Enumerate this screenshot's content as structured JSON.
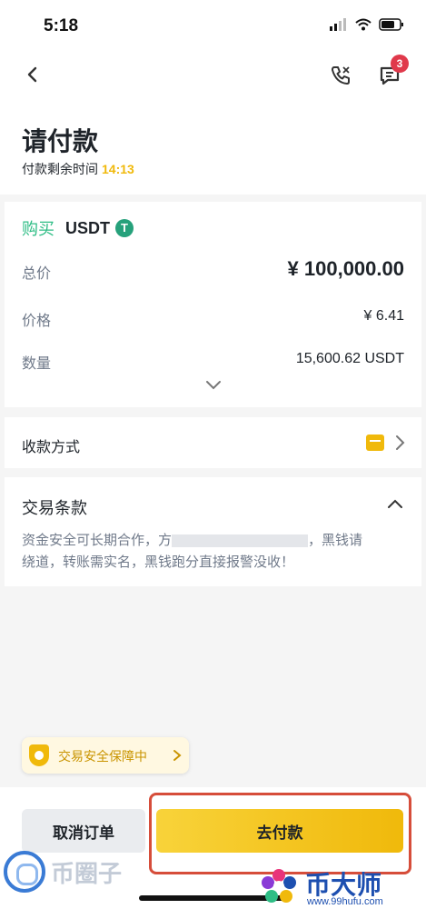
{
  "status_bar": {
    "time": "5:18"
  },
  "nav": {
    "chat_badge": "3"
  },
  "header": {
    "title": "请付款",
    "countdown_label": "付款剩余时间",
    "countdown_value": "14:13"
  },
  "order": {
    "side_label": "购买",
    "asset": "USDT",
    "asset_icon": "T",
    "rows": [
      {
        "label": "总价",
        "value": "¥ 100,000.00"
      },
      {
        "label": "价格",
        "value": "¥ 6.41"
      },
      {
        "label": "数量",
        "value": "15,600.62 USDT"
      }
    ]
  },
  "payment": {
    "label": "收款方式"
  },
  "terms": {
    "title": "交易条款",
    "text_line1_start": "资金安全可长期合作，方",
    "text_line1_end": "，黑钱请",
    "text_line2": "绕道，转账需实名，黑钱跑分直接报警没收！"
  },
  "guarantee": {
    "label": "交易安全保障中"
  },
  "actions": {
    "cancel_label": "取消订单",
    "pay_label": "去付款"
  },
  "watermarks": {
    "left_text": "币圈子",
    "right_text": "币大师",
    "right_url": "www.99hufu.com"
  },
  "colors": {
    "accent": "#f0b90b",
    "buy_green": "#2ebd85",
    "badge_red": "#e0394b",
    "highlight_red": "#d64d3a"
  }
}
